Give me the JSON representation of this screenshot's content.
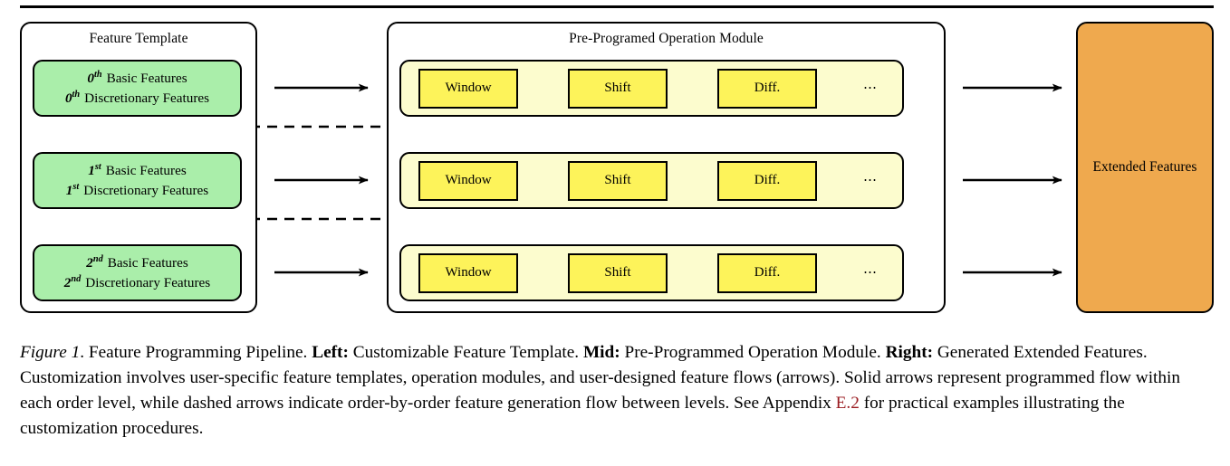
{
  "figure": {
    "panels": {
      "left_title": "Feature Template",
      "mid_title": "Pre-Programed Operation Module",
      "right_label": "Extended Features"
    },
    "templates": [
      {
        "ordinal": "0",
        "suffix": "th",
        "line1": "Basic Features",
        "line2": "Discretionary Features"
      },
      {
        "ordinal": "1",
        "suffix": "st",
        "line1": "Basic Features",
        "line2": "Discretionary Features"
      },
      {
        "ordinal": "2",
        "suffix": "nd",
        "line1": "Basic Features",
        "line2": "Discretionary Features"
      }
    ],
    "operations": [
      "Window",
      "Shift",
      "Diff."
    ],
    "op_ellipsis": "⋯",
    "colors": {
      "template_fill": "#aaeeaa",
      "op_row_fill": "#fcfcce",
      "op_cell_fill": "#fdf35a",
      "extended_fill": "#efa94e",
      "stroke": "#000000",
      "link": "#9a1b20"
    }
  },
  "caption": {
    "fignum": "Figure 1",
    "t1": ". Feature Programming Pipeline. ",
    "b1": "Left:",
    "t2": " Customizable Feature Template. ",
    "b2": "Mid:",
    "t3": " Pre-Programmed Operation Module. ",
    "b3": "Right:",
    "t4": " Generated Extended Features. Customization involves user-specific feature templates, operation modules, and user-designed feature flows (arrows). Solid arrows represent programmed flow within each order level, while dashed arrows indicate order-by-order feature generation flow between levels. See Appendix ",
    "ref": "E.2",
    "t5": " for practical examples illustrating the customization procedures."
  }
}
